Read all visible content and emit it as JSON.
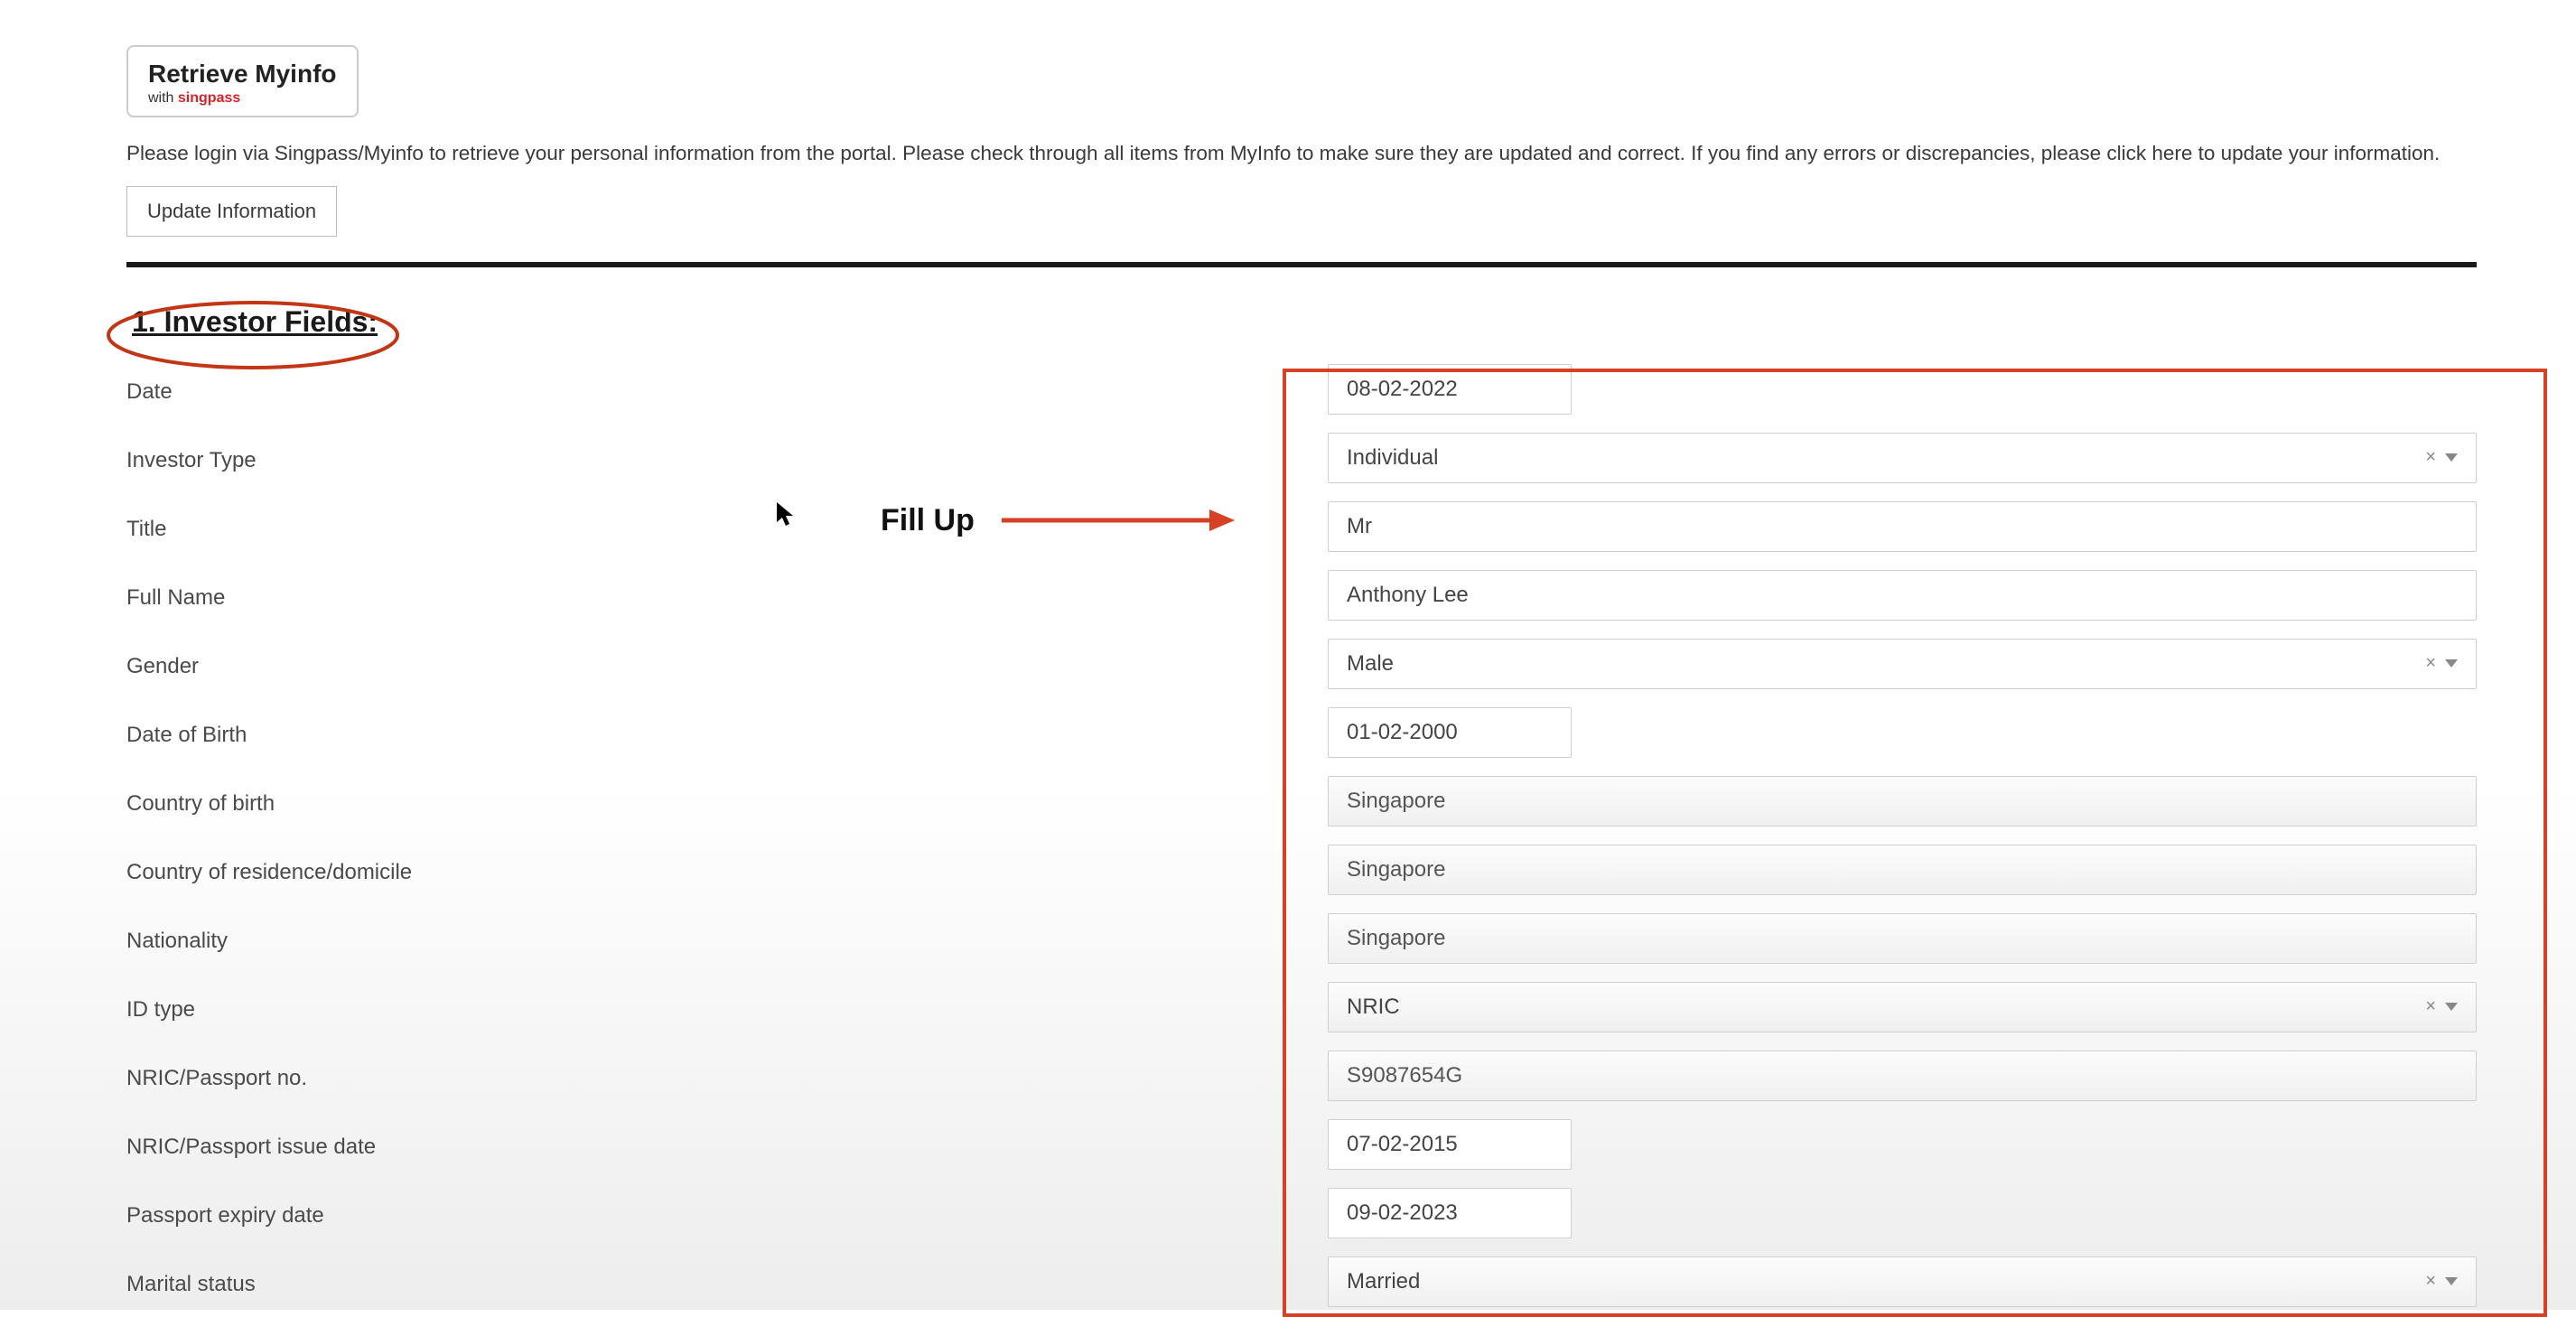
{
  "header": {
    "retrieve_title": "Retrieve Myinfo",
    "retrieve_with": "with ",
    "retrieve_brand": "singpass",
    "info_text": "Please login via Singpass/Myinfo to retrieve your personal information from the portal. Please check through all items from MyInfo to make sure they are updated and correct. If you find any errors or discrepancies, please click here to update your information.",
    "update_btn": "Update Information"
  },
  "section_title": "1. Investor Fields:",
  "annotation": "Fill Up",
  "fields": {
    "date": {
      "label": "Date",
      "value": "08-02-2022"
    },
    "investor_type": {
      "label": "Investor Type",
      "value": "Individual"
    },
    "title": {
      "label": "Title",
      "value": "Mr"
    },
    "full_name": {
      "label": "Full Name",
      "value": "Anthony Lee"
    },
    "gender": {
      "label": "Gender",
      "value": "Male"
    },
    "dob": {
      "label": "Date of Birth",
      "value": "01-02-2000"
    },
    "country_birth": {
      "label": "Country of birth",
      "value": "Singapore"
    },
    "country_res": {
      "label": "Country of residence/domicile",
      "value": "Singapore"
    },
    "nationality": {
      "label": "Nationality",
      "value": "Singapore"
    },
    "id_type": {
      "label": "ID type",
      "value": "NRIC"
    },
    "nric_no": {
      "label": "NRIC/Passport no.",
      "value": "S9087654G"
    },
    "nric_issue": {
      "label": "NRIC/Passport issue date",
      "value": "07-02-2015"
    },
    "passport_exp": {
      "label": "Passport expiry date",
      "value": "09-02-2023"
    },
    "marital": {
      "label": "Marital status",
      "value": "Married"
    }
  }
}
